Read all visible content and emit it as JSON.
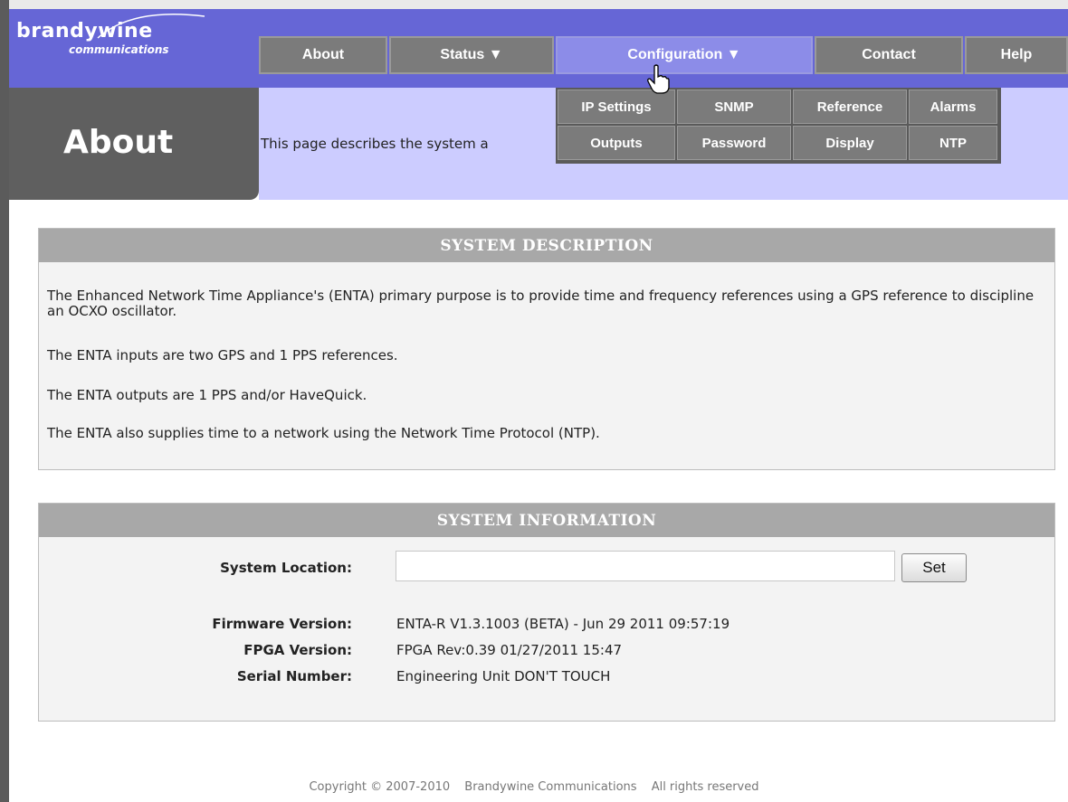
{
  "brand": {
    "name": "brandywine",
    "sub": "communications"
  },
  "nav": [
    {
      "label": "About"
    },
    {
      "label": "Status ▼"
    },
    {
      "label": "Configuration ▼"
    },
    {
      "label": "Contact"
    },
    {
      "label": "Help"
    }
  ],
  "dropdown": [
    {
      "label": "IP Settings"
    },
    {
      "label": "SNMP"
    },
    {
      "label": "Reference"
    },
    {
      "label": "Alarms"
    },
    {
      "label": "Outputs"
    },
    {
      "label": "Password"
    },
    {
      "label": "Display"
    },
    {
      "label": "NTP"
    }
  ],
  "page": {
    "title": "About",
    "description_visible": "This page describes the system a"
  },
  "system_description": {
    "heading": "SYSTEM DESCRIPTION",
    "paragraphs": [
      "The Enhanced Network Time Appliance's (ENTA) primary purpose is to provide time and frequency references using a GPS reference to discipline an OCXO oscillator.",
      "The ENTA inputs are two GPS and 1 PPS references.",
      "The ENTA outputs are 1 PPS and/or HaveQuick.",
      "The ENTA also supplies time to a network using the Network Time Protocol (NTP)."
    ]
  },
  "system_information": {
    "heading": "SYSTEM INFORMATION",
    "location_label": "System Location:",
    "location_value": "",
    "set_label": "Set",
    "firmware_label": "Firmware Version:",
    "firmware_value": "ENTA-R V1.3.1003 (BETA) - Jun 29 2011 09:57:19",
    "fpga_label": "FPGA Version:",
    "fpga_value": "FPGA Rev:0.39 01/27/2011 15:47",
    "serial_label": "Serial Number:",
    "serial_value": "Engineering Unit DON'T TOUCH"
  },
  "footer": {
    "copyright": "Copyright © 2007-2010",
    "company": "Brandywine Communications",
    "rights": "All rights reserved"
  }
}
